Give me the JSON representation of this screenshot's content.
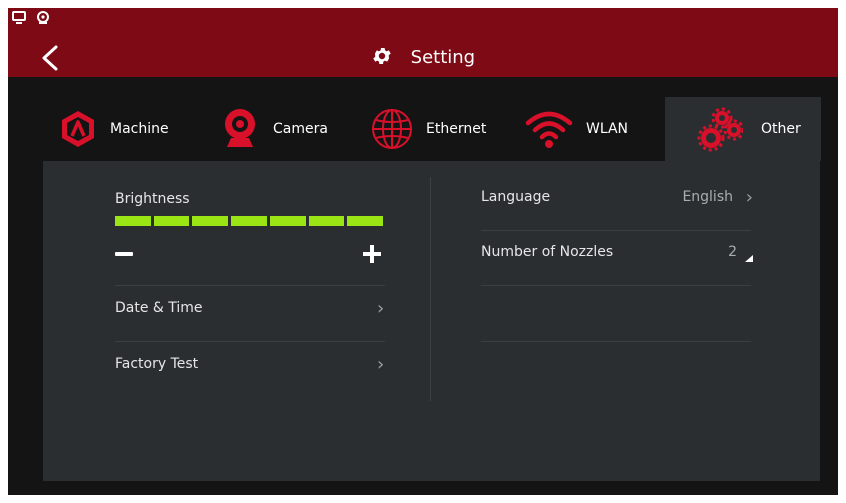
{
  "header": {
    "title": "Setting"
  },
  "tabs": [
    {
      "label": "Machine"
    },
    {
      "label": "Camera"
    },
    {
      "label": "Ethernet"
    },
    {
      "label": "WLAN"
    },
    {
      "label": "Other",
      "active": true
    }
  ],
  "left_panel": {
    "brightness": {
      "label": "Brightness",
      "level_segments": 7,
      "total_segments": 7
    },
    "date_time": {
      "label": "Date & Time"
    },
    "factory_test": {
      "label": "Factory Test"
    }
  },
  "right_panel": {
    "language": {
      "label": "Language",
      "value": "English"
    },
    "nozzles": {
      "label": "Number of Nozzles",
      "value": "2"
    }
  },
  "colors": {
    "header": "#7d0a14",
    "accent_red": "#d8102a",
    "brightness": "#9be515",
    "panel": "#2b2e31"
  },
  "icons": [
    "monitor-icon",
    "webcam-icon",
    "back-arrow-icon",
    "gear-icon",
    "machine-icon",
    "camera-icon",
    "ethernet-globe-icon",
    "wifi-icon",
    "gears-icon",
    "chevron-right-icon",
    "triangle-up-icon",
    "minus-icon",
    "plus-icon"
  ]
}
